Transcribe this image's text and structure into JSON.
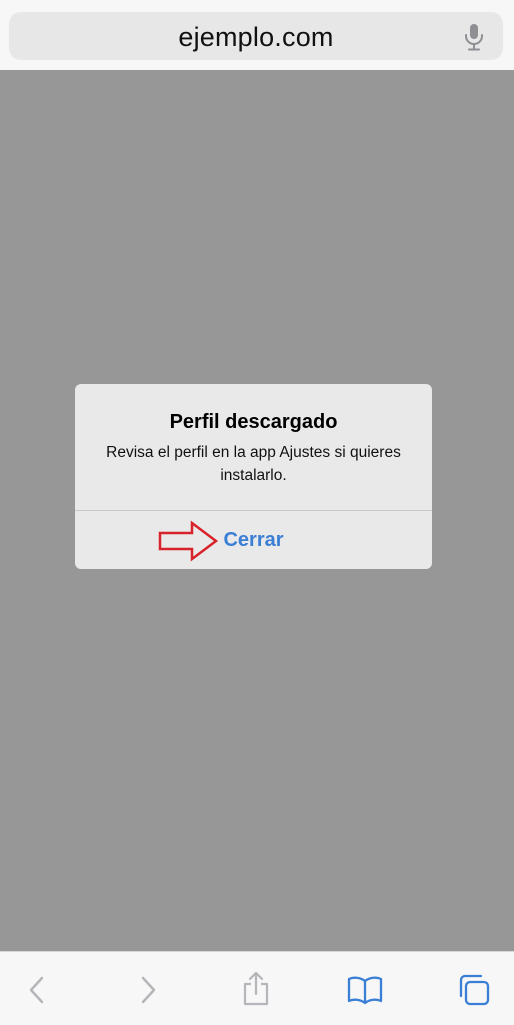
{
  "browser": {
    "address_bar": {
      "url": "ejemplo.com",
      "mic_icon": "microphone-icon"
    },
    "toolbar": {
      "buttons": [
        {
          "icon": "back-chevron-icon",
          "enabled": false
        },
        {
          "icon": "forward-chevron-icon",
          "enabled": false
        },
        {
          "icon": "share-icon",
          "enabled": false
        },
        {
          "icon": "bookmarks-book-icon",
          "enabled": true
        },
        {
          "icon": "tabs-icon",
          "enabled": true
        }
      ]
    }
  },
  "alert": {
    "title": "Perfil descargado",
    "message": "Revisa el perfil en la app Ajustes si quieres instalarlo.",
    "button_label": "Cerrar"
  },
  "colors": {
    "accent_blue": "#3a7fd5",
    "annotation_red": "#d8232a",
    "disabled_gray": "#a9a9ae"
  }
}
